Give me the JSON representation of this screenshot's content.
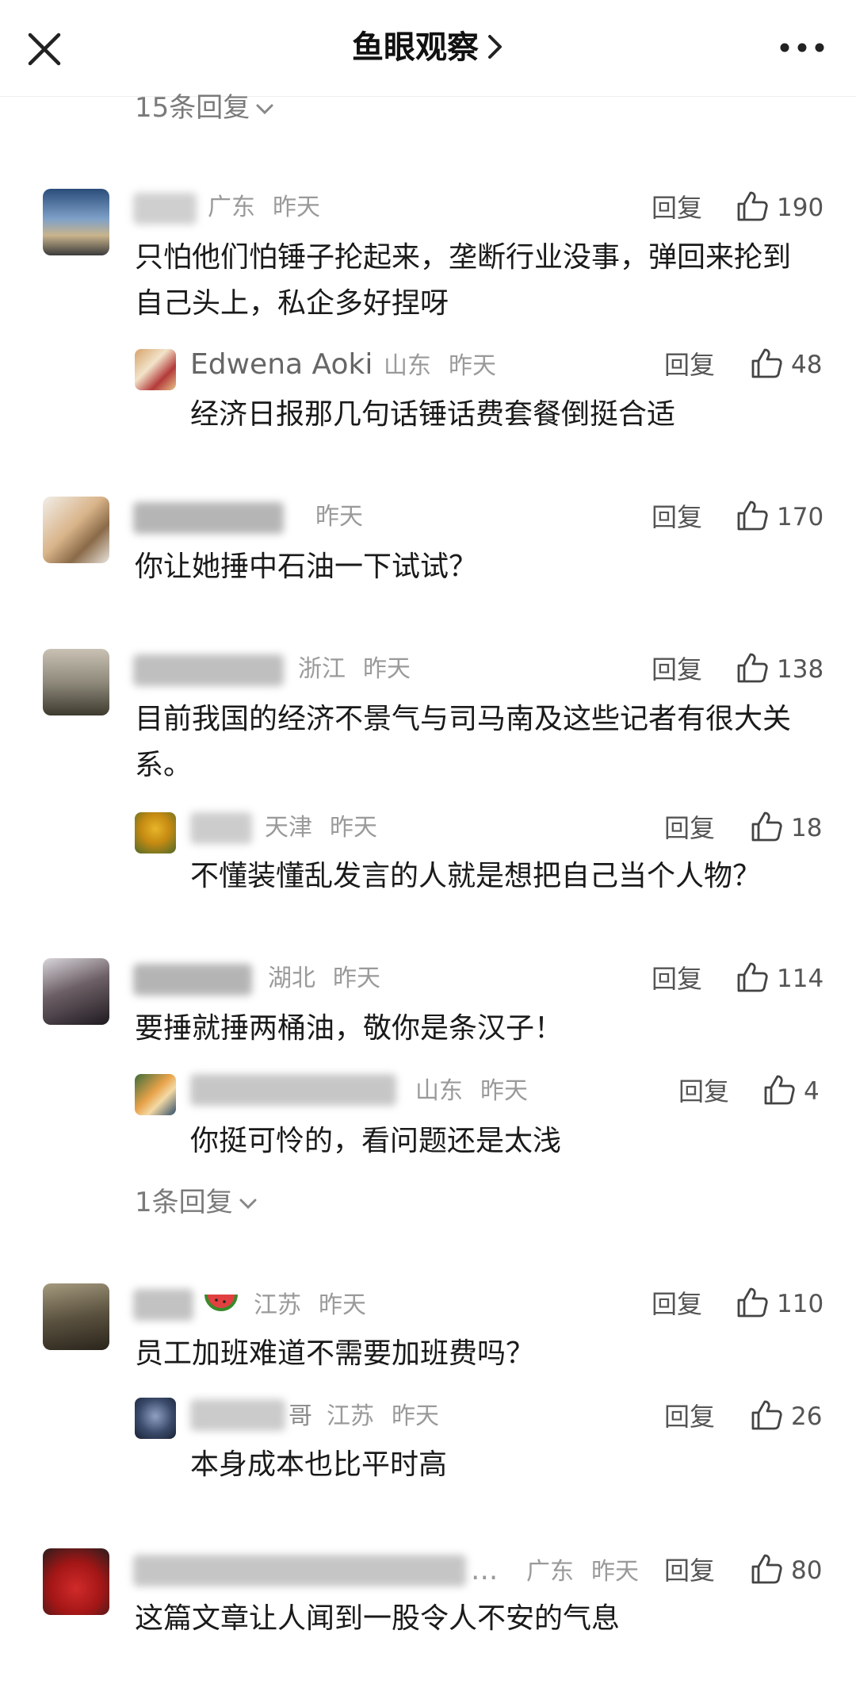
{
  "header": {
    "title": "鱼眼观察"
  },
  "top_replies": "15条回复",
  "colors": {
    "accent": "#111111",
    "meta": "#9a9a9a"
  },
  "comments": [
    {
      "region": "广东",
      "time": "昨天",
      "reply": "回复",
      "likes": "190",
      "text": "只怕他们怕锤子抡起来，垄断行业没事，弹回来抡到自己头上，私企多好捏呀",
      "sub": {
        "name": "Edwena Aoki",
        "region": "山东",
        "time": "昨天",
        "reply": "回复",
        "likes": "48",
        "text": "经济日报那几句话锤话费套餐倒挺合适"
      }
    },
    {
      "region": "",
      "time": "昨天",
      "reply": "回复",
      "likes": "170",
      "text": "你让她捶中石油一下试试？"
    },
    {
      "region": "浙江",
      "time": "昨天",
      "reply": "回复",
      "likes": "138",
      "text": "目前我国的经济不景气与司马南及这些记者有很大关系。",
      "sub": {
        "region": "天津",
        "time": "昨天",
        "reply": "回复",
        "likes": "18",
        "text": "不懂装懂乱发言的人就是想把自己当个人物？"
      }
    },
    {
      "region": "湖北",
      "time": "昨天",
      "reply": "回复",
      "likes": "114",
      "text": "要捶就捶两桶油，敬你是条汉子！",
      "sub": {
        "region": "山东",
        "time": "昨天",
        "reply": "回复",
        "likes": "4",
        "text": "你挺可怜的，看问题还是太浅"
      },
      "more_replies": "1条回复"
    },
    {
      "region": "江苏",
      "time": "昨天",
      "reply": "回复",
      "likes": "110",
      "text": "员工加班难道不需要加班费吗？",
      "sub": {
        "name_tail": "哥",
        "region": "江苏",
        "time": "昨天",
        "reply": "回复",
        "likes": "26",
        "text": "本身成本也比平时高"
      }
    },
    {
      "name": "...",
      "region": "广东",
      "time": "昨天",
      "reply": "回复",
      "likes": "80",
      "text": "这篇文章让人闻到一股令人不安的气息"
    }
  ]
}
